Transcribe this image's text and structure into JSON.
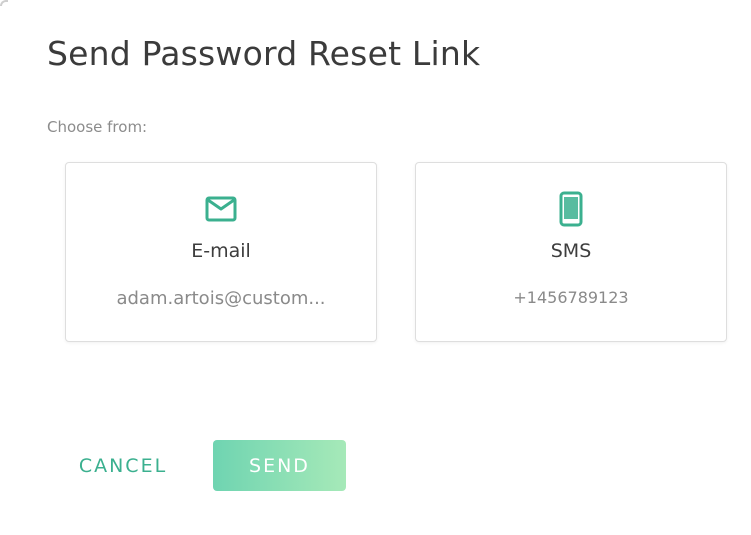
{
  "dialog": {
    "title": "Send Password Reset Link",
    "choose_label": "Choose from:"
  },
  "options": [
    {
      "icon": "envelope-icon",
      "title": "E-mail",
      "detail": "adam.artois@custom..."
    },
    {
      "icon": "smartphone-icon",
      "title": "SMS",
      "detail": "+1456789123"
    }
  ],
  "actions": {
    "cancel_label": "CANCEL",
    "send_label": "SEND"
  },
  "colors": {
    "accent": "#3bb08f",
    "send_gradient_start": "#6fd4b1",
    "send_gradient_end": "#a6e9b8"
  }
}
